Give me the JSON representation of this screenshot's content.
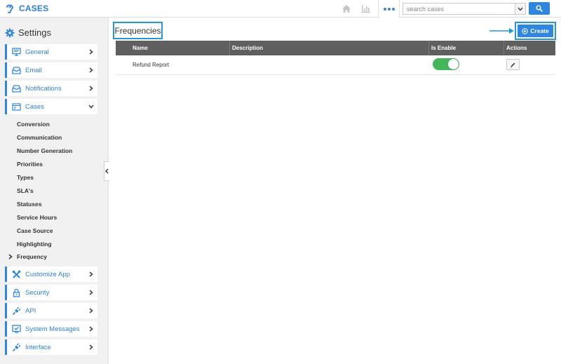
{
  "app": {
    "name": "CASES"
  },
  "search": {
    "placeholder": "search cases"
  },
  "sidebar": {
    "title": "Settings",
    "top_items": [
      {
        "label": "General",
        "icon": "monitor-icon"
      },
      {
        "label": "Email",
        "icon": "inbox-icon"
      },
      {
        "label": "Notifications",
        "icon": "inbox-icon"
      },
      {
        "label": "Cases",
        "icon": "cases-icon"
      }
    ],
    "sub_items": [
      "Conversion",
      "Communication",
      "Number Generation",
      "Priorities",
      "Types",
      "SLA's",
      "Statuses",
      "Service Hours",
      "Case Source",
      "Highlighting",
      "Frequency"
    ],
    "bottom_items": [
      {
        "label": "Customize App",
        "icon": "tools-icon"
      },
      {
        "label": "Security",
        "icon": "lock-icon"
      },
      {
        "label": "API",
        "icon": "plug-icon"
      },
      {
        "label": "System Messages",
        "icon": "message-check-icon"
      },
      {
        "label": "Interface",
        "icon": "plug-icon"
      }
    ]
  },
  "main": {
    "title": "Frequencies",
    "create_label": "Create",
    "table": {
      "columns": [
        "Name",
        "Description",
        "Is Enable",
        "Actions"
      ],
      "rows": [
        {
          "name": "Refund Report",
          "description": "",
          "enabled": true
        }
      ]
    }
  },
  "colors": {
    "accent": "#2f86e0",
    "highlight_border": "#2596d9",
    "toggle_on": "#43b65a",
    "table_header": "#5f5f5f"
  }
}
